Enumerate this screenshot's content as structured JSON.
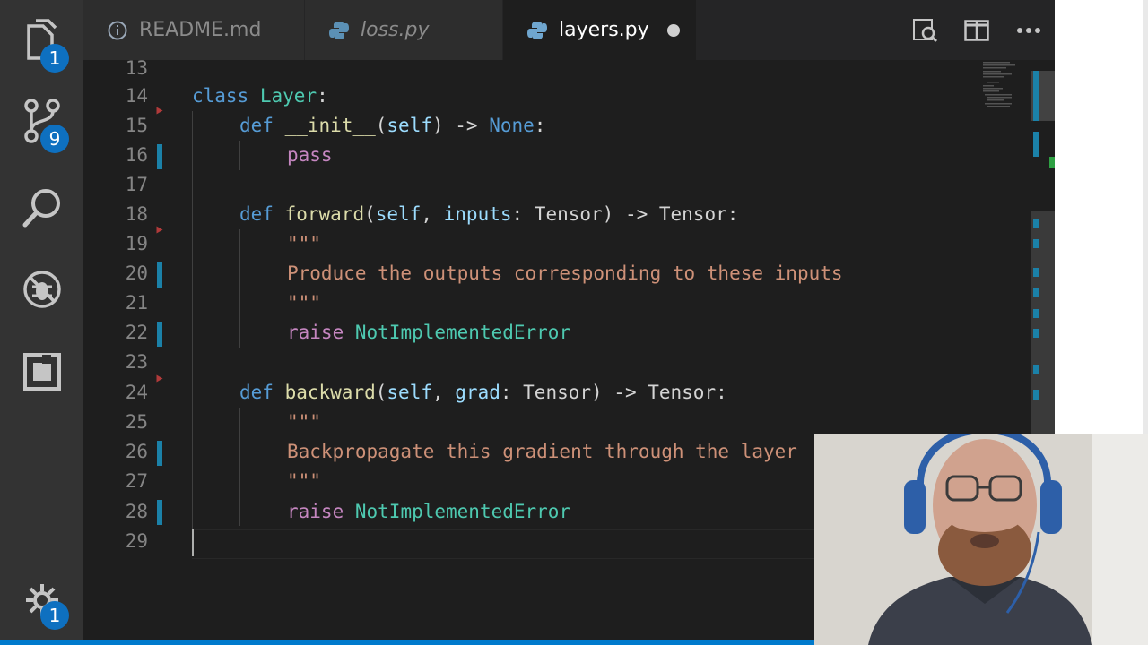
{
  "activity_bar": {
    "explorer_badge": "1",
    "scm_badge": "9",
    "settings_badge": "1",
    "icons": [
      "files-icon",
      "source-control-icon",
      "search-icon",
      "debug-icon",
      "extensions-icon",
      "gear-icon"
    ]
  },
  "tabs": [
    {
      "label": "README.md",
      "icon": "info-icon",
      "italic": false,
      "active": false
    },
    {
      "label": "loss.py",
      "icon": "python-icon",
      "italic": true,
      "active": false
    },
    {
      "label": "layers.py",
      "icon": "python-icon",
      "italic": false,
      "active": true,
      "dirty": true
    }
  ],
  "tab_actions": [
    "open-preview-icon",
    "split-editor-icon",
    "more-actions-icon"
  ],
  "editor": {
    "line_numbers": [
      "13",
      "14",
      "15",
      "16",
      "17",
      "18",
      "19",
      "20",
      "21",
      "22",
      "23",
      "24",
      "25",
      "26",
      "27",
      "28",
      "29"
    ],
    "lines": {
      "l14": {
        "kw": "class",
        "name": "Layer",
        "end": ":"
      },
      "l15": {
        "kw": "def",
        "name": "__init__",
        "open": "(",
        "self": "self",
        "close": ") -> ",
        "ret": "None",
        "end": ":"
      },
      "l16": {
        "kw": "pass"
      },
      "l18": {
        "kw": "def",
        "name": "forward",
        "open": "(",
        "self": "self",
        "sep": ", ",
        "param": "inputs",
        "colon": ": ",
        "type": "Tensor",
        "close": ") -> ",
        "ret": "Tensor",
        "end": ":"
      },
      "l19": {
        "str": "\"\"\""
      },
      "l20": {
        "str": "Produce the outputs corresponding to these inputs"
      },
      "l21": {
        "str": "\"\"\""
      },
      "l22": {
        "kw": "raise",
        "space": " ",
        "err": "NotImplementedError"
      },
      "l24": {
        "kw": "def",
        "name": "backward",
        "open": "(",
        "self": "self",
        "sep": ", ",
        "param": "grad",
        "colon": ": ",
        "type": "Tensor",
        "close": ") -> ",
        "ret": "Tensor",
        "end": ":"
      },
      "l25": {
        "str": "\"\"\""
      },
      "l26": {
        "str": "Backpropagate this gradient through the layer"
      },
      "l27": {
        "str": "\"\"\""
      },
      "l28": {
        "kw": "raise",
        "space": " ",
        "err": "NotImplementedError"
      }
    }
  },
  "colors": {
    "editor_bg": "#1e1e1e",
    "activity_bar": "#333333",
    "badge": "#0e70c0",
    "keyword": "#569cd6",
    "control": "#c586c0",
    "class": "#4ec9b0",
    "function": "#dcdcaa",
    "param": "#9cdcfe",
    "string": "#ce9178",
    "status_bar": "#007acc"
  }
}
